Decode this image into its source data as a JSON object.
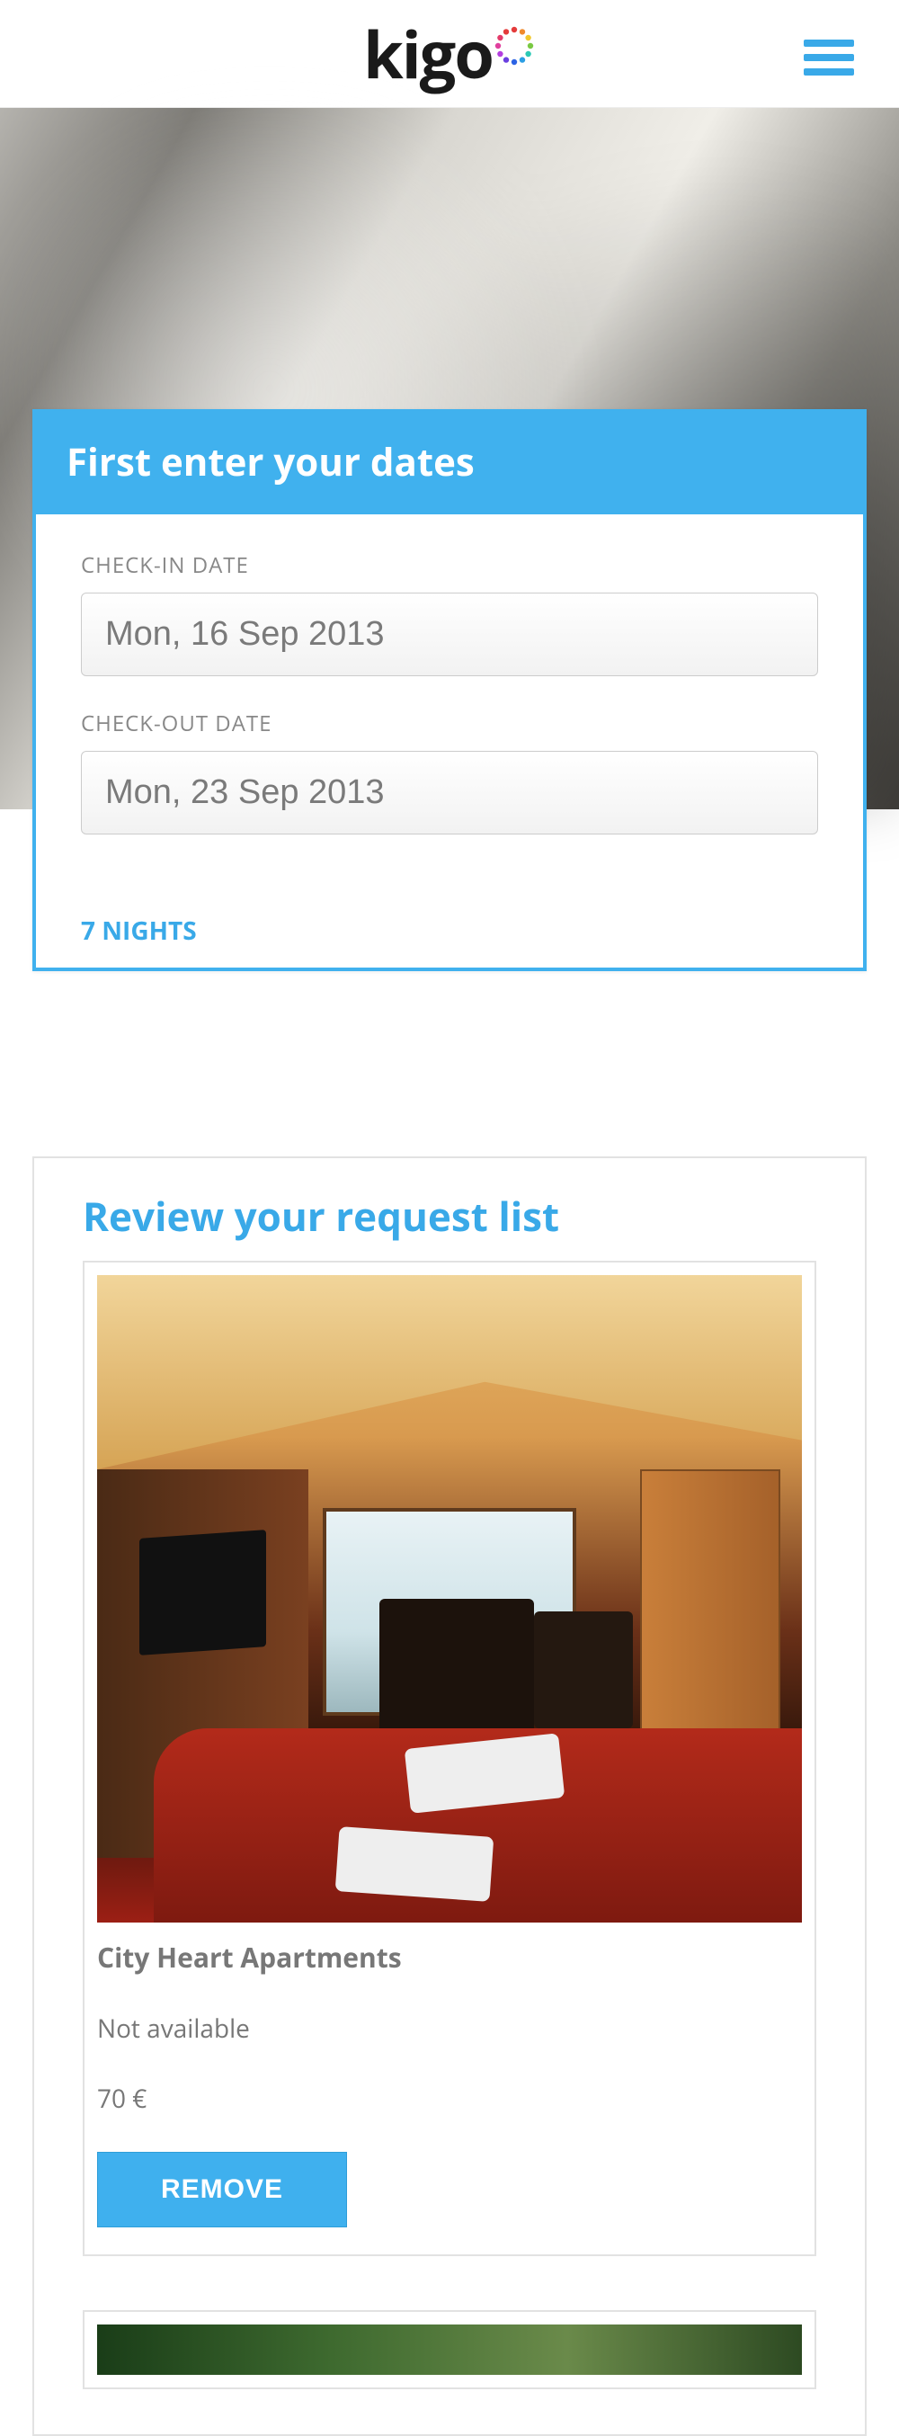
{
  "header": {
    "brand": "kigo"
  },
  "dates_panel": {
    "title": "First enter your dates",
    "checkin_label": "CHECK-IN DATE",
    "checkin_value": "Mon, 16 Sep 2013",
    "checkout_label": "CHECK-OUT DATE",
    "checkout_value": "Mon, 23 Sep 2013",
    "nights": "7 NIGHTS"
  },
  "review": {
    "title": "Review your request list",
    "listings": [
      {
        "name": "City Heart Apartments",
        "status": "Not available",
        "price": "70 €",
        "remove_label": "REMOVE"
      }
    ]
  },
  "colors": {
    "primary": "#39a9e8"
  }
}
